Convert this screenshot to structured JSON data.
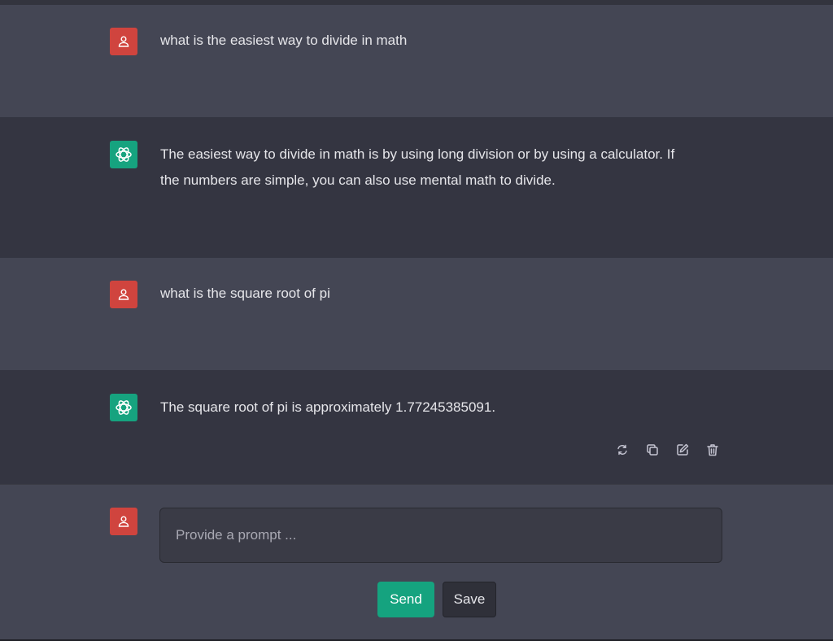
{
  "messages": [
    {
      "role": "user",
      "icon": "user-icon",
      "text": "what is the easiest way to divide in math"
    },
    {
      "role": "assistant",
      "icon": "openai-logo-icon",
      "text": "The easiest way to divide in math is by using long division or by using a calculator. If the numbers are simple, you can also use mental math to divide."
    },
    {
      "role": "user",
      "icon": "user-icon",
      "text": "what is the square root of pi"
    },
    {
      "role": "assistant",
      "icon": "openai-logo-icon",
      "text": "The square root of pi is approximately 1.77245385091."
    }
  ],
  "message_actions": [
    "regenerate-icon",
    "copy-icon",
    "edit-icon",
    "delete-icon"
  ],
  "composer": {
    "placeholder": "Provide a prompt ...",
    "value": "",
    "send_label": "Send",
    "save_label": "Save"
  },
  "colors": {
    "user_bg": "#444654",
    "assistant_bg": "#343541",
    "user_avatar": "#d0443e",
    "assistant_avatar": "#16a37f",
    "accent": "#15a37f"
  }
}
